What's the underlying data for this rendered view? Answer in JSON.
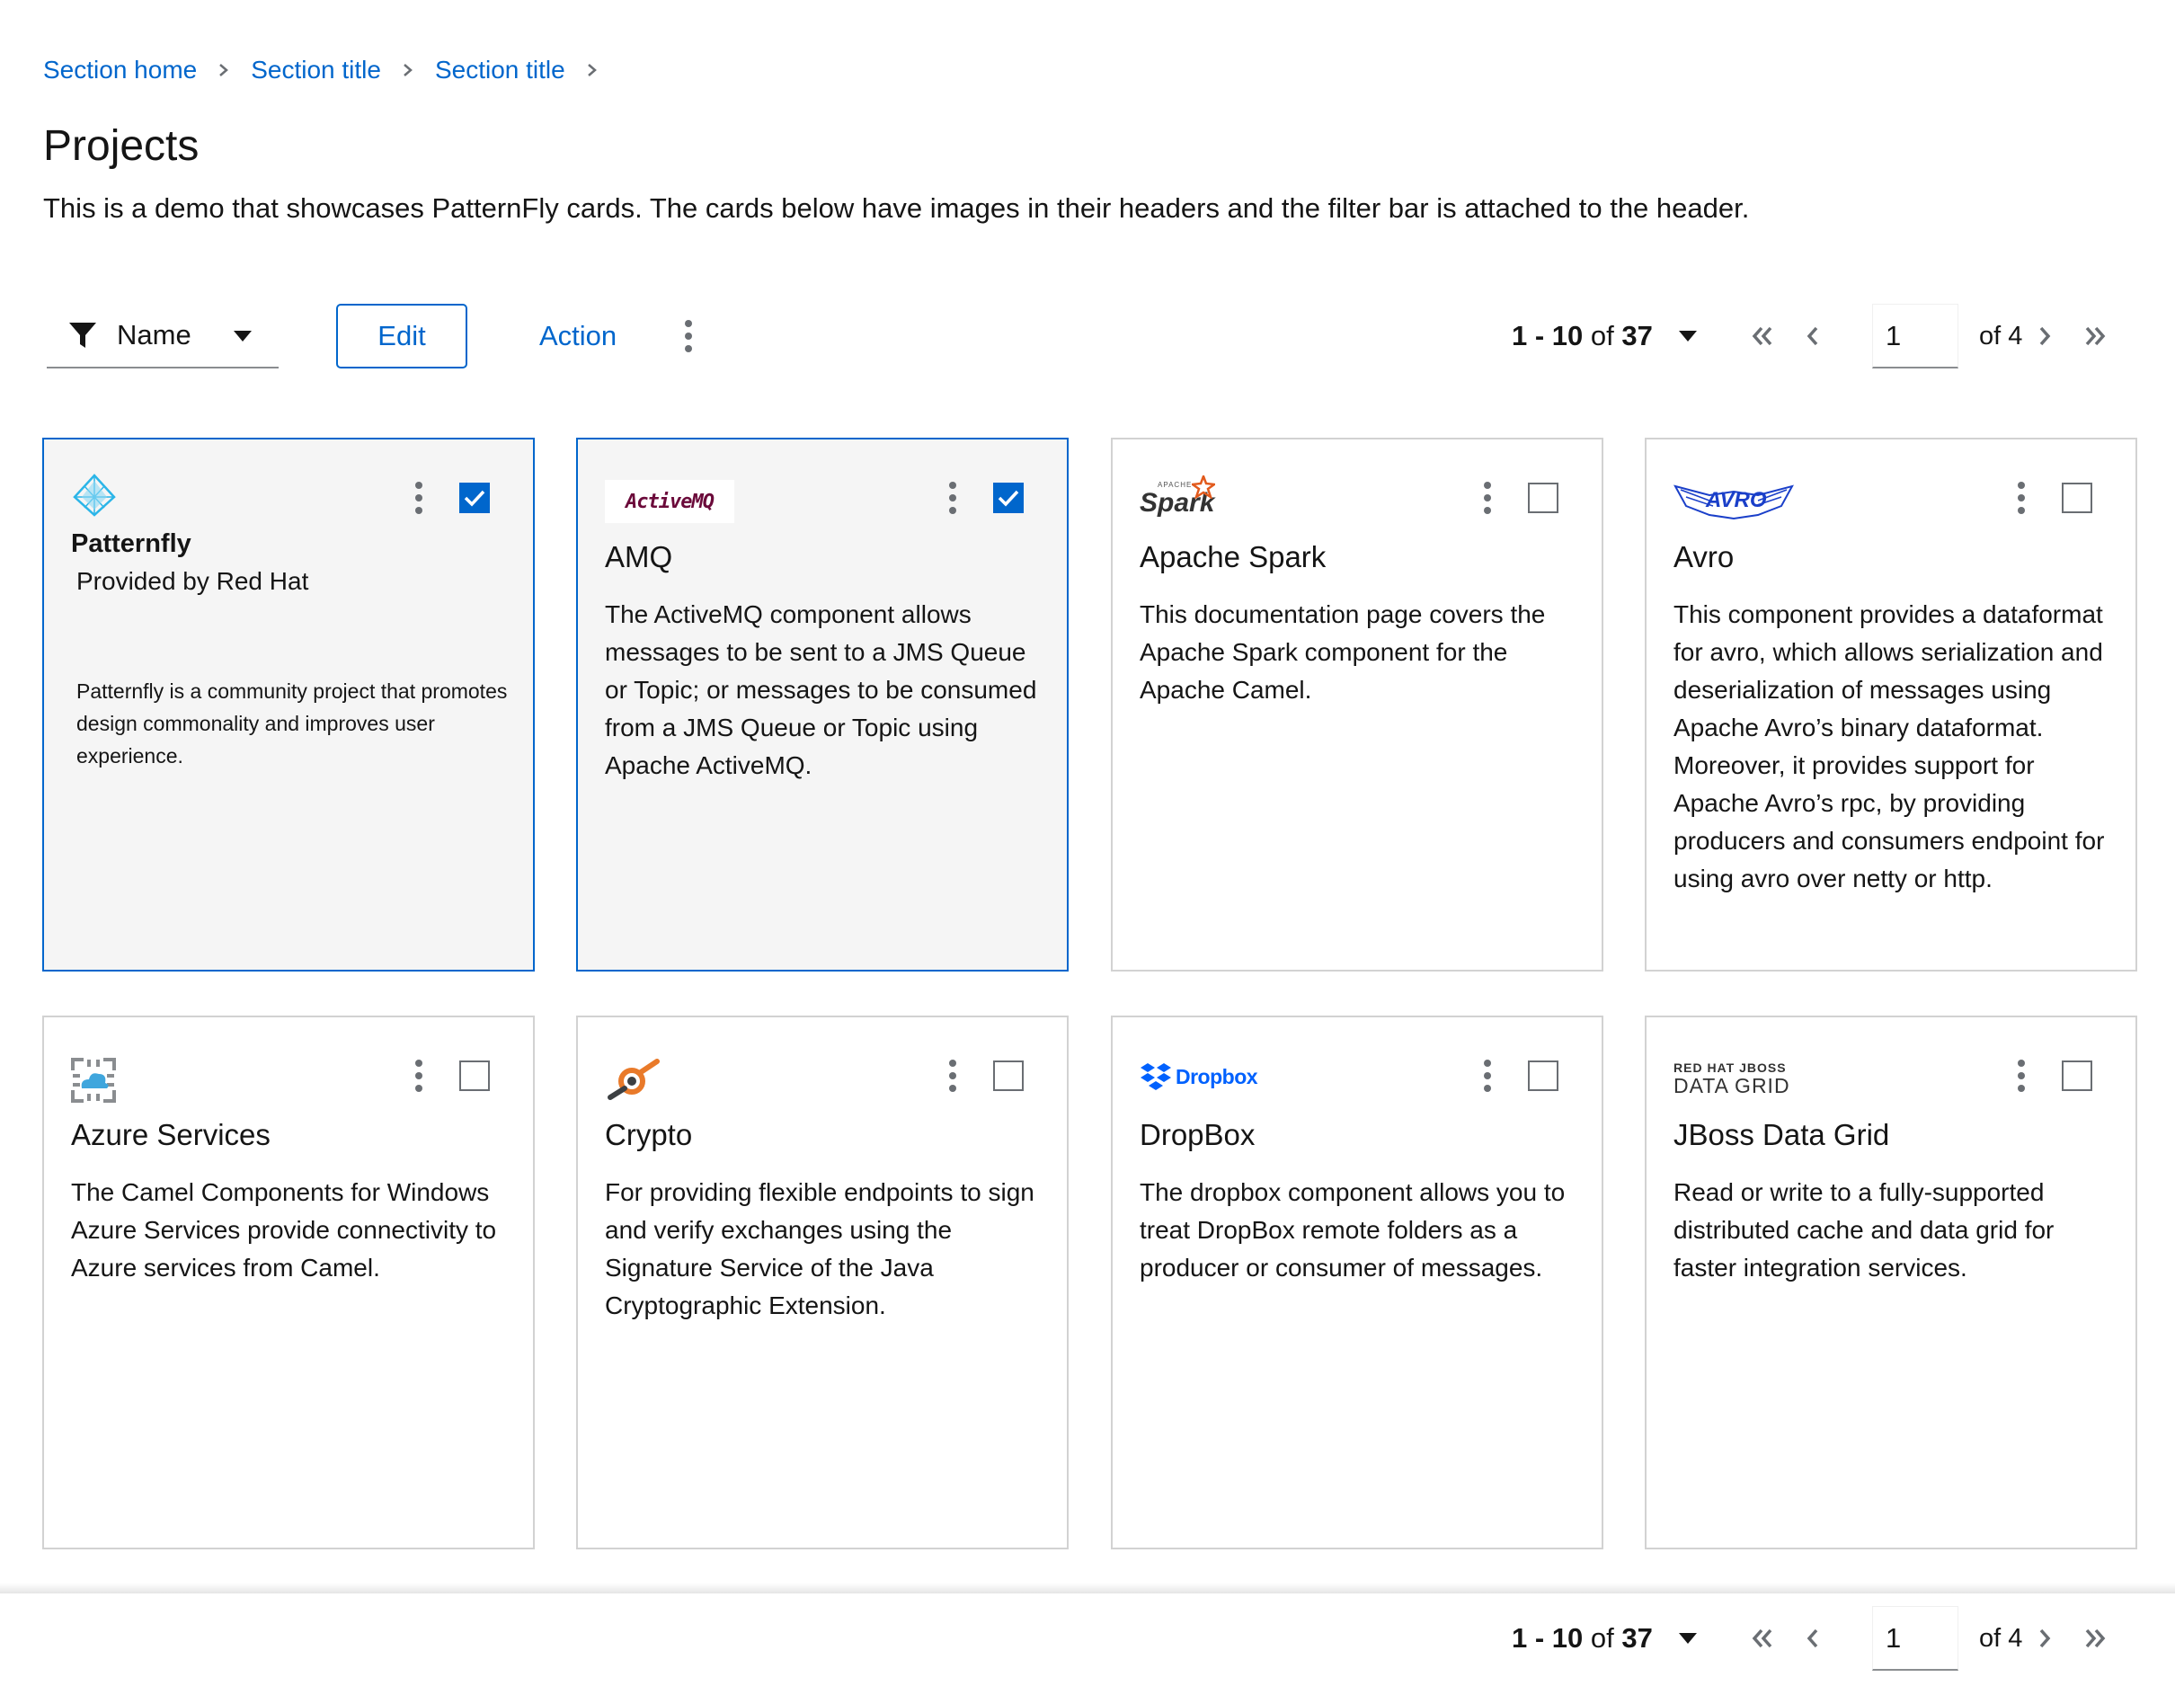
{
  "breadcrumb": {
    "items": [
      "Section home",
      "Section title",
      "Section title"
    ]
  },
  "page": {
    "title": "Projects",
    "description": "This is a demo that showcases PatternFly cards. The cards below have images in their headers and the filter bar is attached to the header."
  },
  "toolbar": {
    "filter_label": "Name",
    "edit_label": "Edit",
    "action_label": "Action"
  },
  "pagination": {
    "range": "1 - 10",
    "of_word": "of",
    "total": "37",
    "current_page": "1",
    "page_total_label": "of 4"
  },
  "cards": [
    {
      "title": "Patternfly",
      "subtitle": "Provided by Red Hat",
      "body": "Patternfly is a community project that promotes design commonality and improves user experience.",
      "logo": "patternfly-logo",
      "selected": true
    },
    {
      "title": "AMQ",
      "body": "The ActiveMQ component allows messages to be sent to a JMS Queue or Topic; or messages to be consumed from a JMS Queue or Topic using Apache ActiveMQ.",
      "logo": "activemq-logo",
      "logo_text": "ActiveMQ",
      "selected": true
    },
    {
      "title": "Apache Spark",
      "body": "This documentation page covers the Apache Spark component for the Apache Camel.",
      "logo": "spark-logo",
      "logo_text": "Spark",
      "logo_small_text": "APACHE",
      "selected": false
    },
    {
      "title": "Avro",
      "body": "This component provides a dataformat for avro, which allows serialization and deserialization of messages using Apache Avro’s binary dataformat. Moreover, it provides support for Apache Avro’s rpc, by providing producers and consumers endpoint for using avro over netty or http.",
      "logo": "avro-logo",
      "logo_text": "AVRO",
      "selected": false
    },
    {
      "title": "Azure Services",
      "body": "The Camel Components for Windows Azure Services provide connectivity to Azure services from Camel.",
      "logo": "azure-logo",
      "selected": false
    },
    {
      "title": "Crypto",
      "body": "For providing flexible endpoints to sign and verify exchanges using the Signature Service of the Java Cryptographic Extension.",
      "logo": "crypto-logo",
      "selected": false
    },
    {
      "title": "DropBox",
      "body": "The dropbox component allows you to treat DropBox remote folders as a producer or consumer of messages.",
      "logo": "dropbox-logo",
      "logo_text": "Dropbox",
      "selected": false
    },
    {
      "title": "JBoss Data Grid",
      "body": "Read or write to a fully-supported distributed cache and data grid for faster integration services.",
      "logo": "jboss-logo",
      "logo_text_top": "RED HAT  JBOSS",
      "logo_text_bottom": "DATA GRID",
      "selected": false
    }
  ],
  "colors": {
    "link": "#0066cc",
    "border": "#d2d2d2",
    "selected_bg": "#f5f5f5",
    "icon_grey": "#6a6e73"
  }
}
